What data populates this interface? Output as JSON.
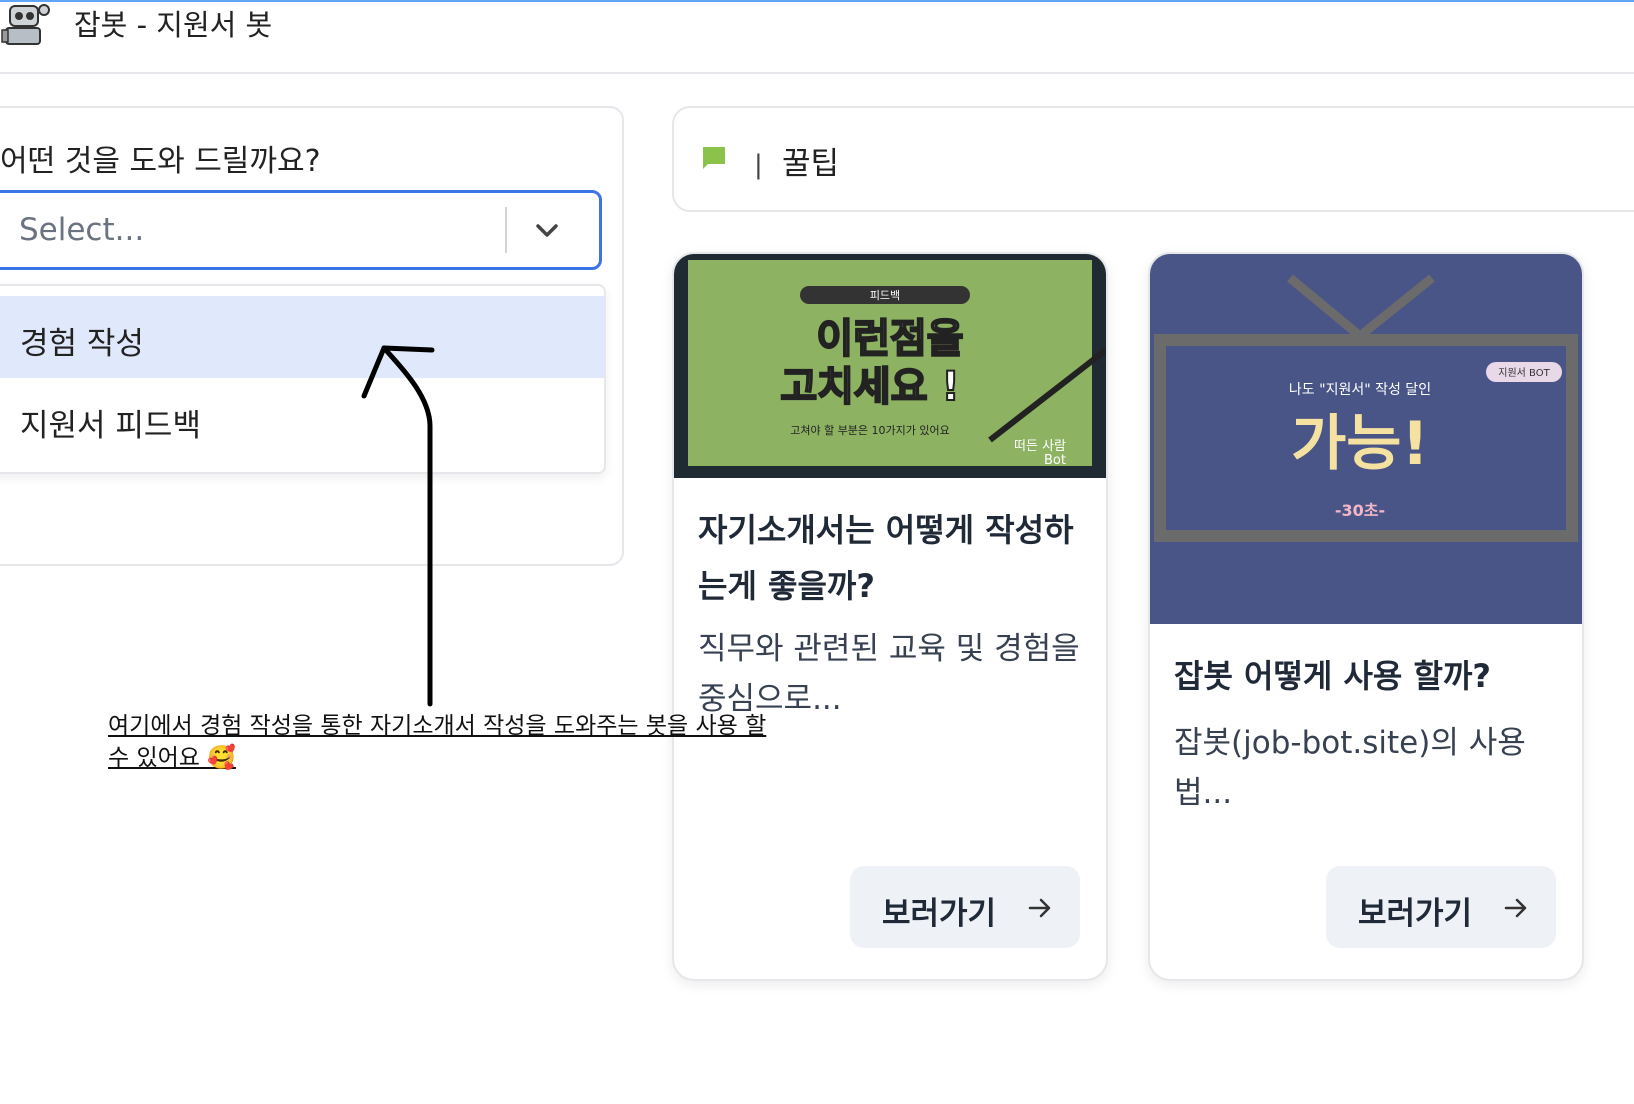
{
  "header": {
    "title": "잡봇 - 지원서 봇",
    "logo_icon": "robot-icon"
  },
  "left_panel": {
    "question": "어떤 것을 도와 드릴까요?",
    "select": {
      "placeholder": "Select...",
      "chevron_icon": "chevron-down-icon"
    },
    "options": [
      {
        "label": "경험 작성",
        "highlighted": true
      },
      {
        "label": "지원서 피드백",
        "highlighted": false
      }
    ]
  },
  "tips": {
    "icon": "chat-bubble-icon",
    "divider": "|",
    "title": "꿀팁",
    "icon_color": "#8bc34a"
  },
  "cards": [
    {
      "thumbnail": {
        "tag": "피드백",
        "headline_line1": "이런점을",
        "headline_line2": "고치세요 !",
        "sub": "고쳐야 할 부분은 10가지가 있어요",
        "signature_line1": "떠든 사람",
        "signature_line2": "Bot"
      },
      "title": "자기소개서는 어떻게 작성하는게 좋을까?",
      "description": "직무와 관련된 교육 및 경험을 중심으로...",
      "button_label": "보러가기",
      "button_icon": "arrow-right-icon"
    },
    {
      "thumbnail": {
        "tag": "지원서 BOT",
        "caption": "나도 \"지원서\" 작성 달인",
        "headline": "가능!",
        "sub": "-30초-"
      },
      "title": "잡봇 어떻게 사용 할까?",
      "description": "잡봇(job-bot.site)의 사용법...",
      "button_label": "보러가기",
      "button_icon": "arrow-right-icon"
    }
  ],
  "annotation": {
    "text": "여기에서 경험 작성을 통한 자기소개서 작성을 도와주는 봇을 사용 할 수 있어요 🥰"
  },
  "colors": {
    "accent": "#3b74e6",
    "option_highlight": "#e0e9fb",
    "card1_thumb_bg": "#8db262",
    "card2_thumb_bg": "#4a5587",
    "button_bg": "#eef1f6"
  }
}
